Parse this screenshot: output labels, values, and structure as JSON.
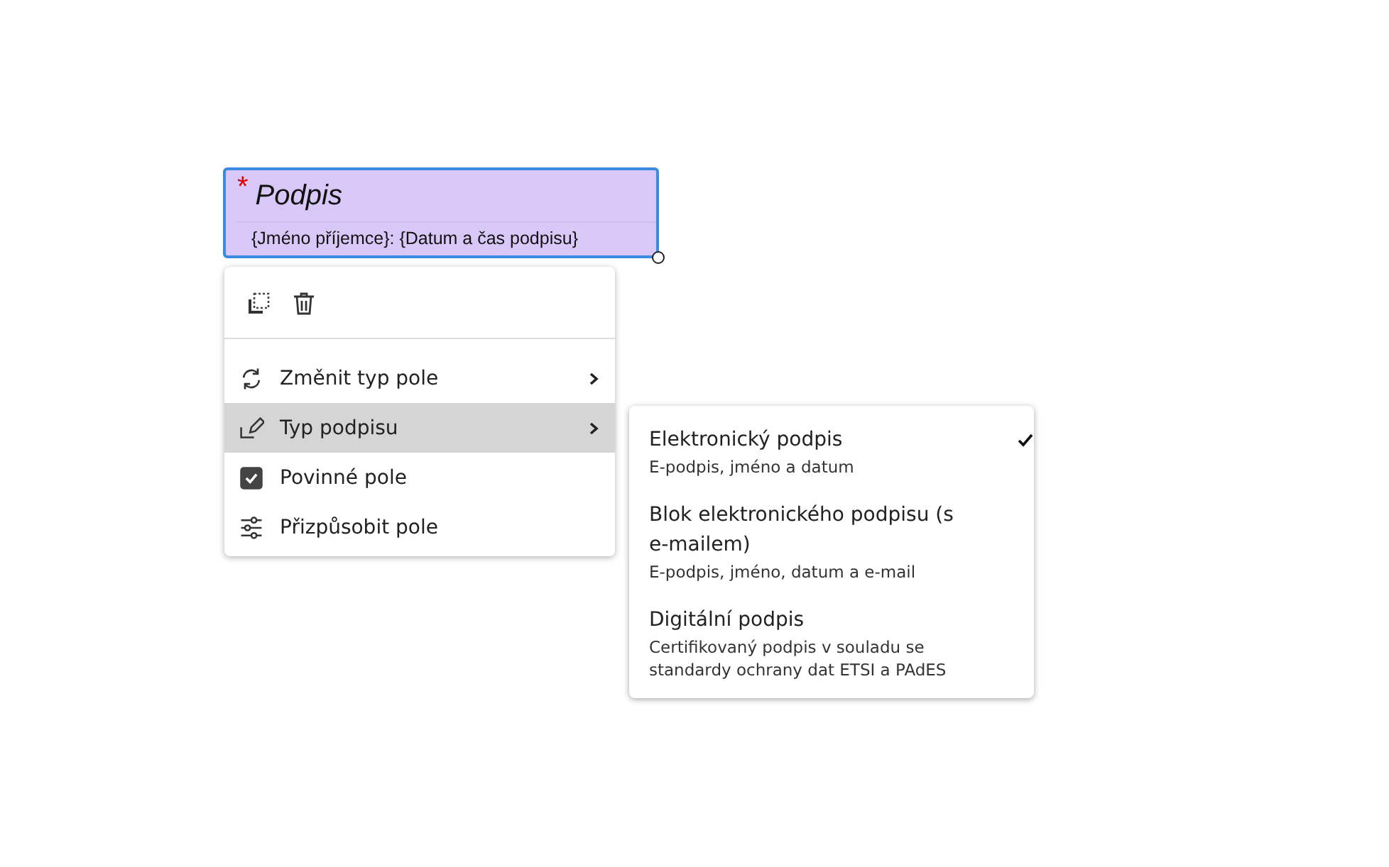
{
  "field": {
    "required": true,
    "required_mark": "*",
    "title": "Podpis",
    "subtitle": "{Jméno příjemce}: {Datum a čas podpisu}",
    "selected": true
  },
  "menu": {
    "items": [
      {
        "kind": "submenu",
        "label": "Změnit typ pole",
        "selected": false
      },
      {
        "kind": "submenu",
        "label": "Typ podpisu",
        "selected": true
      },
      {
        "kind": "checkbox",
        "label": "Povinné pole",
        "checked": true
      },
      {
        "kind": "action",
        "label": "Přizpůsobit pole",
        "selected": false
      }
    ]
  },
  "submenu": {
    "items": [
      {
        "title": "Elektronický podpis",
        "description": "E-podpis, jméno a datum",
        "selected": true
      },
      {
        "title": "Blok elektronického podpisu (s e-mailem)",
        "description": "E-podpis, jméno, datum a e-mail",
        "selected": false
      },
      {
        "title": "Digitální podpis",
        "description": "Certifikovaný podpis v souladu se standardy ochrany dat ETSI a PAdES",
        "selected": false
      }
    ]
  }
}
